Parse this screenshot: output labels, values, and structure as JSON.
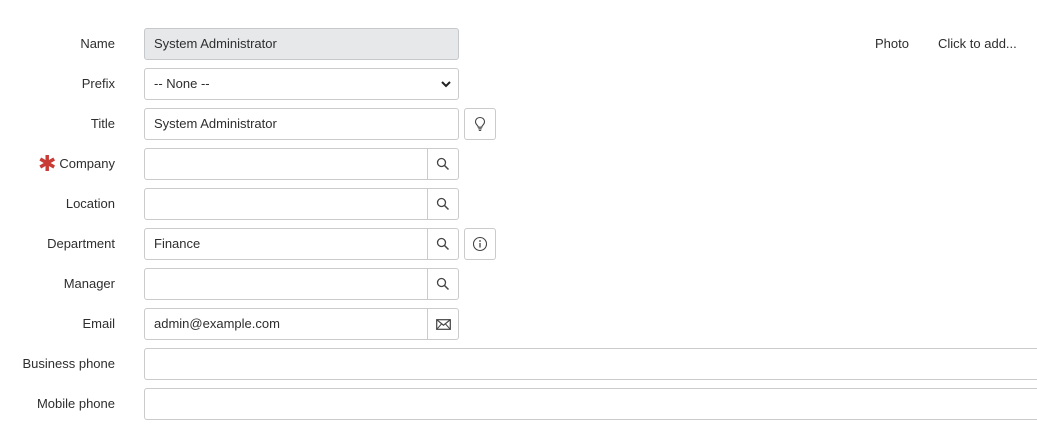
{
  "form": {
    "name": {
      "label": "Name",
      "value": "System Administrator"
    },
    "prefix": {
      "label": "Prefix",
      "value": "-- None --"
    },
    "title": {
      "label": "Title",
      "value": "System Administrator"
    },
    "company": {
      "label": "Company",
      "value": "",
      "required": true
    },
    "location": {
      "label": "Location",
      "value": ""
    },
    "department": {
      "label": "Department",
      "value": "Finance"
    },
    "manager": {
      "label": "Manager",
      "value": ""
    },
    "email": {
      "label": "Email",
      "value": "admin@example.com"
    },
    "business_phone": {
      "label": "Business phone",
      "value": ""
    },
    "mobile_phone": {
      "label": "Mobile phone",
      "value": ""
    }
  },
  "photo": {
    "label": "Photo",
    "action": "Click to add..."
  },
  "required_marker": "✱",
  "icons": {
    "lookup": "search-icon",
    "suggestion": "lightbulb-icon",
    "info": "info-icon",
    "email": "envelope-icon",
    "select": "chevron-down-icon"
  },
  "colors": {
    "required": "#c83c36",
    "readonly_bg": "#e6e8ea",
    "border": "#cbcbcb"
  }
}
